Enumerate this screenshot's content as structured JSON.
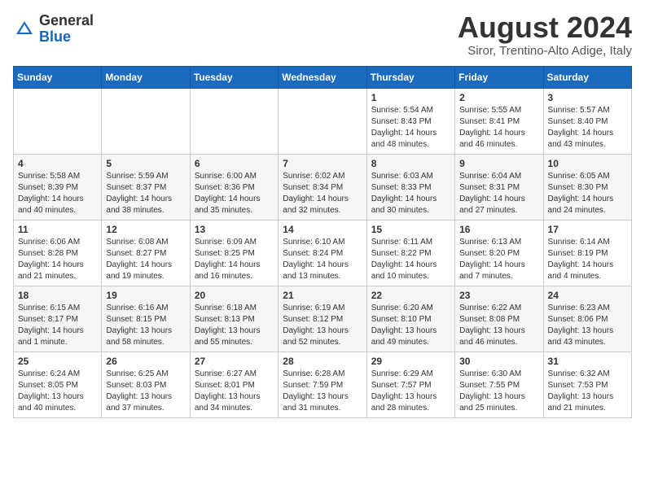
{
  "header": {
    "logo_general": "General",
    "logo_blue": "Blue",
    "month_year": "August 2024",
    "location": "Siror, Trentino-Alto Adige, Italy"
  },
  "days_of_week": [
    "Sunday",
    "Monday",
    "Tuesday",
    "Wednesday",
    "Thursday",
    "Friday",
    "Saturday"
  ],
  "weeks": [
    [
      {
        "day": "",
        "info": ""
      },
      {
        "day": "",
        "info": ""
      },
      {
        "day": "",
        "info": ""
      },
      {
        "day": "",
        "info": ""
      },
      {
        "day": "1",
        "info": "Sunrise: 5:54 AM\nSunset: 8:43 PM\nDaylight: 14 hours\nand 48 minutes."
      },
      {
        "day": "2",
        "info": "Sunrise: 5:55 AM\nSunset: 8:41 PM\nDaylight: 14 hours\nand 46 minutes."
      },
      {
        "day": "3",
        "info": "Sunrise: 5:57 AM\nSunset: 8:40 PM\nDaylight: 14 hours\nand 43 minutes."
      }
    ],
    [
      {
        "day": "4",
        "info": "Sunrise: 5:58 AM\nSunset: 8:39 PM\nDaylight: 14 hours\nand 40 minutes."
      },
      {
        "day": "5",
        "info": "Sunrise: 5:59 AM\nSunset: 8:37 PM\nDaylight: 14 hours\nand 38 minutes."
      },
      {
        "day": "6",
        "info": "Sunrise: 6:00 AM\nSunset: 8:36 PM\nDaylight: 14 hours\nand 35 minutes."
      },
      {
        "day": "7",
        "info": "Sunrise: 6:02 AM\nSunset: 8:34 PM\nDaylight: 14 hours\nand 32 minutes."
      },
      {
        "day": "8",
        "info": "Sunrise: 6:03 AM\nSunset: 8:33 PM\nDaylight: 14 hours\nand 30 minutes."
      },
      {
        "day": "9",
        "info": "Sunrise: 6:04 AM\nSunset: 8:31 PM\nDaylight: 14 hours\nand 27 minutes."
      },
      {
        "day": "10",
        "info": "Sunrise: 6:05 AM\nSunset: 8:30 PM\nDaylight: 14 hours\nand 24 minutes."
      }
    ],
    [
      {
        "day": "11",
        "info": "Sunrise: 6:06 AM\nSunset: 8:28 PM\nDaylight: 14 hours\nand 21 minutes."
      },
      {
        "day": "12",
        "info": "Sunrise: 6:08 AM\nSunset: 8:27 PM\nDaylight: 14 hours\nand 19 minutes."
      },
      {
        "day": "13",
        "info": "Sunrise: 6:09 AM\nSunset: 8:25 PM\nDaylight: 14 hours\nand 16 minutes."
      },
      {
        "day": "14",
        "info": "Sunrise: 6:10 AM\nSunset: 8:24 PM\nDaylight: 14 hours\nand 13 minutes."
      },
      {
        "day": "15",
        "info": "Sunrise: 6:11 AM\nSunset: 8:22 PM\nDaylight: 14 hours\nand 10 minutes."
      },
      {
        "day": "16",
        "info": "Sunrise: 6:13 AM\nSunset: 8:20 PM\nDaylight: 14 hours\nand 7 minutes."
      },
      {
        "day": "17",
        "info": "Sunrise: 6:14 AM\nSunset: 8:19 PM\nDaylight: 14 hours\nand 4 minutes."
      }
    ],
    [
      {
        "day": "18",
        "info": "Sunrise: 6:15 AM\nSunset: 8:17 PM\nDaylight: 14 hours\nand 1 minute."
      },
      {
        "day": "19",
        "info": "Sunrise: 6:16 AM\nSunset: 8:15 PM\nDaylight: 13 hours\nand 58 minutes."
      },
      {
        "day": "20",
        "info": "Sunrise: 6:18 AM\nSunset: 8:13 PM\nDaylight: 13 hours\nand 55 minutes."
      },
      {
        "day": "21",
        "info": "Sunrise: 6:19 AM\nSunset: 8:12 PM\nDaylight: 13 hours\nand 52 minutes."
      },
      {
        "day": "22",
        "info": "Sunrise: 6:20 AM\nSunset: 8:10 PM\nDaylight: 13 hours\nand 49 minutes."
      },
      {
        "day": "23",
        "info": "Sunrise: 6:22 AM\nSunset: 8:08 PM\nDaylight: 13 hours\nand 46 minutes."
      },
      {
        "day": "24",
        "info": "Sunrise: 6:23 AM\nSunset: 8:06 PM\nDaylight: 13 hours\nand 43 minutes."
      }
    ],
    [
      {
        "day": "25",
        "info": "Sunrise: 6:24 AM\nSunset: 8:05 PM\nDaylight: 13 hours\nand 40 minutes."
      },
      {
        "day": "26",
        "info": "Sunrise: 6:25 AM\nSunset: 8:03 PM\nDaylight: 13 hours\nand 37 minutes."
      },
      {
        "day": "27",
        "info": "Sunrise: 6:27 AM\nSunset: 8:01 PM\nDaylight: 13 hours\nand 34 minutes."
      },
      {
        "day": "28",
        "info": "Sunrise: 6:28 AM\nSunset: 7:59 PM\nDaylight: 13 hours\nand 31 minutes."
      },
      {
        "day": "29",
        "info": "Sunrise: 6:29 AM\nSunset: 7:57 PM\nDaylight: 13 hours\nand 28 minutes."
      },
      {
        "day": "30",
        "info": "Sunrise: 6:30 AM\nSunset: 7:55 PM\nDaylight: 13 hours\nand 25 minutes."
      },
      {
        "day": "31",
        "info": "Sunrise: 6:32 AM\nSunset: 7:53 PM\nDaylight: 13 hours\nand 21 minutes."
      }
    ]
  ]
}
